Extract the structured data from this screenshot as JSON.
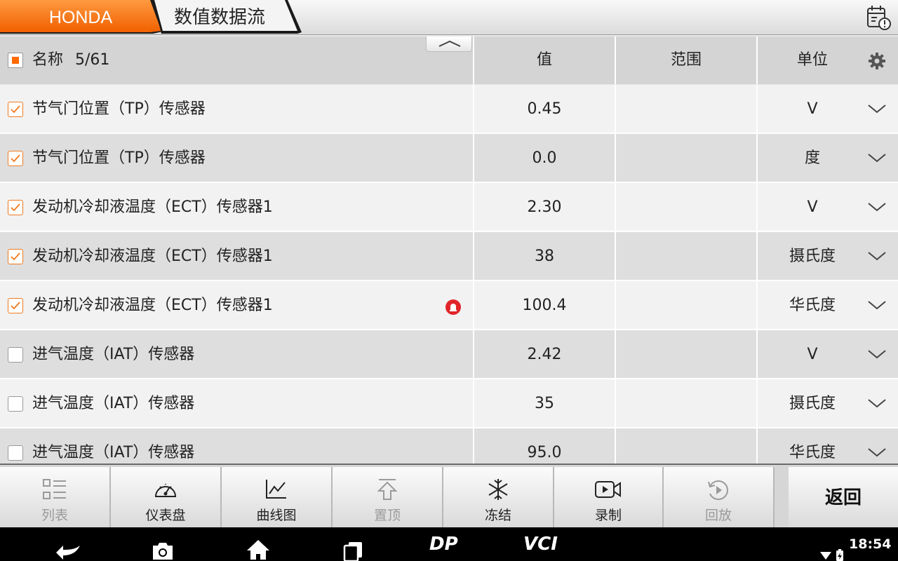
{
  "header": {
    "brand": "HONDA",
    "title": "数值数据流"
  },
  "table": {
    "columns": {
      "name": "名称",
      "count": "5/61",
      "value": "值",
      "range": "范围",
      "unit": "单位"
    },
    "rows": [
      {
        "name": "节气门位置（TP）传感器",
        "value": "0.45",
        "range": "",
        "unit": "V",
        "checked": true,
        "alert": false
      },
      {
        "name": "节气门位置（TP）传感器",
        "value": "0.0",
        "range": "",
        "unit": "度",
        "checked": true,
        "alert": false
      },
      {
        "name": "发动机冷却液温度（ECT）传感器1",
        "value": "2.30",
        "range": "",
        "unit": "V",
        "checked": true,
        "alert": false
      },
      {
        "name": "发动机冷却液温度（ECT）传感器1",
        "value": "38",
        "range": "",
        "unit": "摄氏度",
        "checked": true,
        "alert": false
      },
      {
        "name": "发动机冷却液温度（ECT）传感器1",
        "value": "100.4",
        "range": "",
        "unit": "华氏度",
        "checked": true,
        "alert": true
      },
      {
        "name": "进气温度（IAT）传感器",
        "value": "2.42",
        "range": "",
        "unit": "V",
        "checked": false,
        "alert": false
      },
      {
        "name": "进气温度（IAT）传感器",
        "value": "35",
        "range": "",
        "unit": "摄氏度",
        "checked": false,
        "alert": false
      },
      {
        "name": "进气温度（IAT）传感器",
        "value": "95.0",
        "range": "",
        "unit": "华氏度",
        "checked": false,
        "alert": false
      }
    ]
  },
  "toolbar": {
    "buttons": [
      {
        "label": "列表",
        "icon": "list-icon",
        "disabled": true
      },
      {
        "label": "仪表盘",
        "icon": "gauge-icon",
        "disabled": false
      },
      {
        "label": "曲线图",
        "icon": "line-chart-icon",
        "disabled": false
      },
      {
        "label": "置顶",
        "icon": "pin-top-icon",
        "disabled": true
      },
      {
        "label": "冻结",
        "icon": "snowflake-icon",
        "disabled": false
      },
      {
        "label": "录制",
        "icon": "video-record-icon",
        "disabled": false
      },
      {
        "label": "回放",
        "icon": "playback-icon",
        "disabled": true
      }
    ],
    "back_label": "返回"
  },
  "statusbar": {
    "time": "18:54",
    "nav_dp": "DP",
    "nav_vci": "VCI"
  },
  "colors": {
    "accent": "#ff6a00",
    "alert": "#e0252a"
  }
}
